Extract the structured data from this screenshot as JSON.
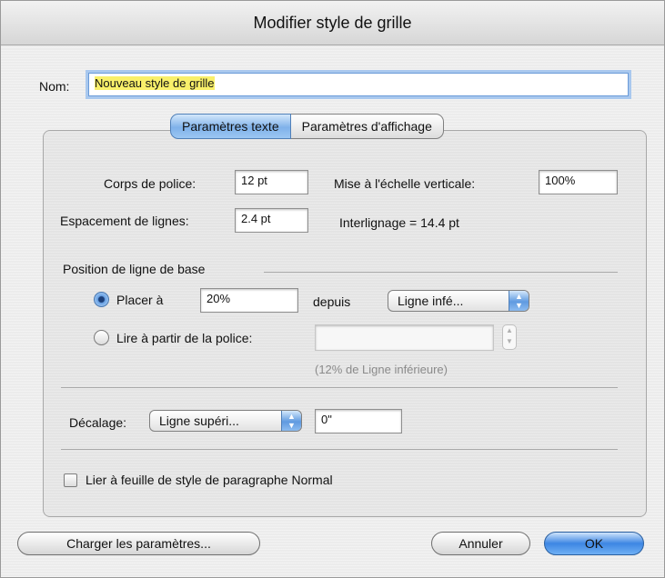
{
  "window": {
    "title": "Modifier style de grille"
  },
  "name": {
    "label": "Nom:",
    "value": "Nouveau style de grille"
  },
  "tabs": [
    {
      "label": "Paramètres texte",
      "active": true
    },
    {
      "label": "Paramètres d'affichage",
      "active": false
    }
  ],
  "text": {
    "font_size_label": "Corps de police:",
    "font_size_value": "12 pt",
    "vscale_label": "Mise à l'échelle verticale:",
    "vscale_value": "100%",
    "line_spacing_label": "Espacement de lignes:",
    "line_spacing_value": "2.4 pt",
    "leading_text": "Interlignage = 14.4 pt"
  },
  "baseline": {
    "section_label": "Position de ligne de base",
    "place_label": "Placer à",
    "place_value": "20%",
    "from_label": "depuis",
    "from_select": "Ligne infé...",
    "read_label": "Lire à partir de la police:",
    "read_value": "",
    "read_hint": "(12% de Ligne inférieure)"
  },
  "offset": {
    "label": "Décalage:",
    "select": "Ligne supéri...",
    "value": "0\""
  },
  "link": {
    "label": "Lier à feuille de style de paragraphe Normal",
    "checked": false
  },
  "buttons": {
    "load": "Charger les paramètres...",
    "cancel": "Annuler",
    "ok": "OK"
  },
  "colors": {
    "accent": "#5f9ae0",
    "highlight": "#f9f06a"
  },
  "icons": {
    "popup": "up-down-arrows-icon"
  }
}
